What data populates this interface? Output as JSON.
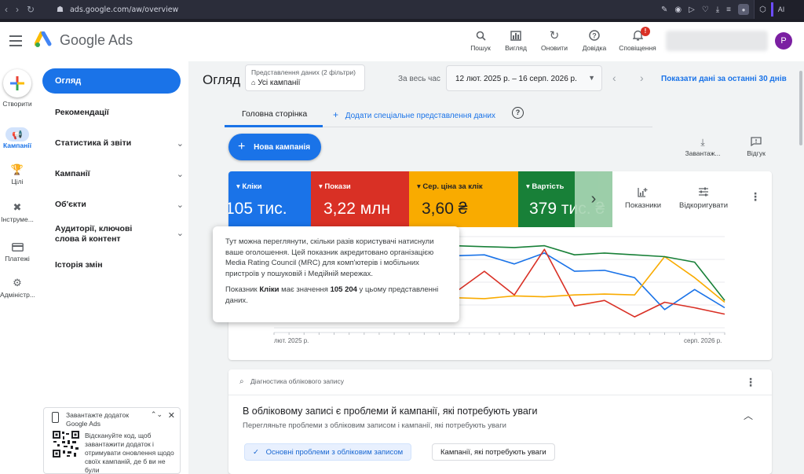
{
  "browser": {
    "url": "ads.google.com/aw/overview",
    "ext_label": "AI"
  },
  "header": {
    "product": "Google Ads",
    "buttons": [
      {
        "icon": "search-icon",
        "label": "Пошук"
      },
      {
        "icon": "view-icon",
        "label": "Вигляд"
      },
      {
        "icon": "refresh-icon",
        "label": "Оновити"
      },
      {
        "icon": "help-icon",
        "label": "Довідка"
      },
      {
        "icon": "bell-icon",
        "label": "Сповіщення",
        "badge": "!"
      }
    ],
    "avatar_letter": "P"
  },
  "rail": {
    "create_label": "Створити",
    "items": [
      {
        "icon": "megaphone-icon",
        "label": "Кампанії",
        "active": true
      },
      {
        "icon": "trophy-icon",
        "label": "Цілі"
      },
      {
        "icon": "tools-icon",
        "label": "Інструме..."
      },
      {
        "icon": "card-icon",
        "label": "Платежі"
      },
      {
        "icon": "gear-icon",
        "label": "Адміністр..."
      }
    ]
  },
  "sidenav": {
    "active": "Огляд",
    "items": [
      {
        "label": "Рекомендації",
        "chevron": false
      },
      {
        "label": "Статистика й звіти",
        "chevron": true
      },
      {
        "label": "Кампанії",
        "chevron": true
      },
      {
        "label": "Об'єкти",
        "chevron": true
      },
      {
        "label": "Аудиторії, ключові слова й контент",
        "chevron": true
      },
      {
        "label": "Історія змін",
        "chevron": false
      }
    ]
  },
  "promo": {
    "title": "Завантажте додаток Google Ads",
    "body": "Відскануйте код, щоб завантажити додаток і отримувати оновлення щодо своїх кампаній, де б ви не були"
  },
  "main": {
    "title": "Огляд",
    "view_label": "Представлення даних (2 фільтри)",
    "view_value": "Усі кампанії",
    "period_label": "За весь час",
    "date_range": "12 лют. 2025 р. – 16 серп. 2026 р.",
    "show_30": "Показати дані за останні 30 днів",
    "tab_home": "Головна сторінка",
    "tab_add": "Додати спеціальне представлення даних",
    "new_campaign": "Нова кампанія",
    "download": "Завантаж...",
    "feedback": "Відгук"
  },
  "metrics": {
    "tiles": [
      {
        "label": "Кліки",
        "value": "105 тис.",
        "color": "#1a73e8"
      },
      {
        "label": "Покази",
        "value": "3,22 млн",
        "color": "#d93025"
      },
      {
        "label": "Сер. ціна за клік",
        "value": "3,60 ₴",
        "color": "#f9ab00"
      },
      {
        "label": "Вартість",
        "value": "379 тис. ₴",
        "color": "#188038"
      }
    ],
    "indicators": "Показники",
    "adjust": "Відкоригувати"
  },
  "chart_data": {
    "type": "line",
    "x_ticks": [
      "лют. 2025 р.",
      "серп. 2026 р."
    ],
    "series": [
      {
        "color": "#1a73e8",
        "values": [
          0.86,
          0.87,
          0.8,
          0.84,
          0.81,
          0.82,
          0.79,
          0.8,
          0.7,
          0.82,
          0.62,
          0.63,
          0.55,
          0.2,
          0.42,
          0.22
        ]
      },
      {
        "color": "#d93025",
        "values": [
          0.72,
          0.86,
          0.45,
          0.83,
          0.4,
          0.7,
          0.38,
          0.62,
          0.36,
          0.86,
          0.24,
          0.3,
          0.12,
          0.28,
          0.22,
          0.15
        ]
      },
      {
        "color": "#f9ab00",
        "values": [
          0.35,
          0.32,
          0.3,
          0.33,
          0.32,
          0.34,
          0.33,
          0.32,
          0.35,
          0.34,
          0.36,
          0.37,
          0.36,
          0.78,
          0.55,
          0.28
        ]
      },
      {
        "color": "#188038",
        "values": [
          0.9,
          0.9,
          0.88,
          0.89,
          0.89,
          0.88,
          0.9,
          0.89,
          0.88,
          0.9,
          0.8,
          0.82,
          0.8,
          0.78,
          0.72,
          0.3
        ]
      }
    ]
  },
  "tooltip": {
    "text": "Тут можна переглянути, скільки разів користувачі натиснули ваше оголошення. Цей показник акредитовано організацією Media Rating Council (MRC) для комп'ютерів і мобільних пристроїв у пошуковій і Медійній мережах.",
    "prefix": "Показник ",
    "metric": "Кліки",
    "middle": " має значення ",
    "value": "105 204",
    "suffix": " у цьому представленні даних."
  },
  "diagnostics": {
    "header": "Діагностика облікового запису",
    "title": "В обліковому записі є проблеми й кампанії, які потребують уваги",
    "subtitle": "Перегляньте проблеми з обліковим записом і кампанії, які потребують уваги",
    "chip1": "Основні проблеми з обліковим записом",
    "chip2": "Кампанії, які потребують уваги"
  }
}
